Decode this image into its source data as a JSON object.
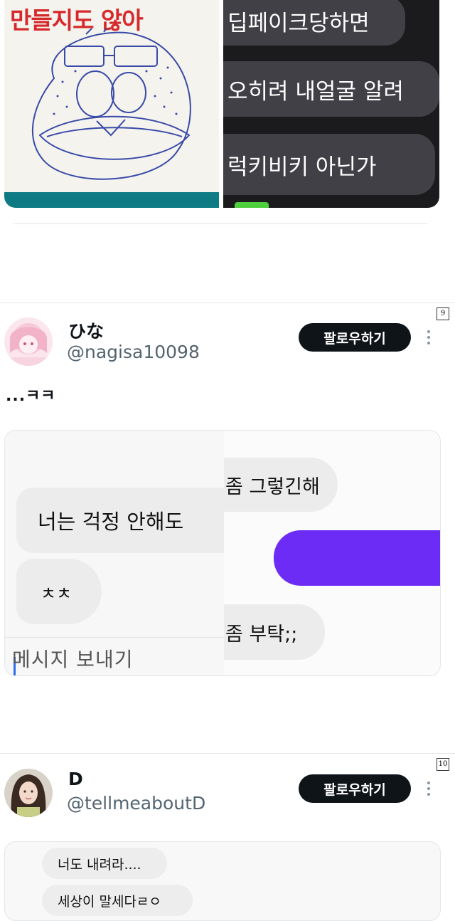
{
  "top_media": {
    "sketch_caption": "만들지도 않아",
    "chat_lines": [
      "딥페이크당하면",
      "오히려 내얼굴 알려",
      "럭키비키 아닌가"
    ]
  },
  "tweets": [
    {
      "index_tag": "9",
      "display_name": "ひな",
      "handle": "@nagisa10098",
      "follow_label": "팔로우하기",
      "text": "...ㅋㅋ",
      "chat": {
        "left_bubbles": [
          "너는 걱정 안해도",
          "ㅊㅊ"
        ],
        "input_placeholder": "메시지 보내기",
        "right_bubbles": [
          "좀 그렇긴해",
          "좀 부탁;;"
        ]
      }
    },
    {
      "index_tag": "10",
      "display_name": "D",
      "handle": "@tellmeaboutD",
      "follow_label": "팔로우하기",
      "chat": {
        "bubbles": [
          "너도 내려라....",
          "세상이 말세다ㄹㅇ"
        ]
      }
    }
  ],
  "colors": {
    "follow_bg": "#0f1419",
    "handle": "#536471",
    "chat_purple": "#6c2cf5",
    "caption_red": "#d6292b"
  }
}
